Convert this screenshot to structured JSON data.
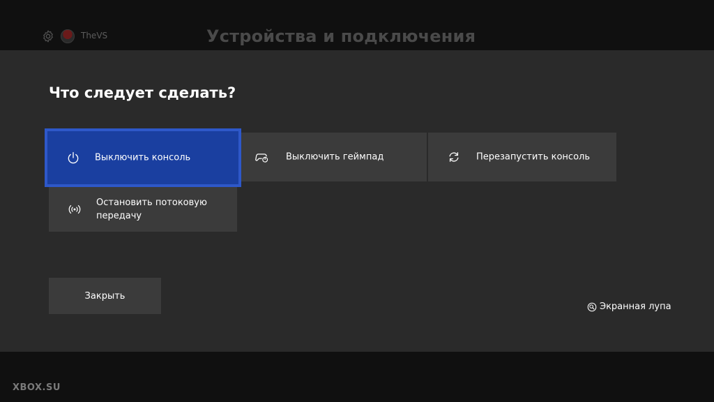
{
  "background": {
    "user_name": "TheVS",
    "page_title": "Устройства и подключения"
  },
  "dialog": {
    "title": "Что следует сделать?",
    "options": [
      {
        "label": "Выключить консоль",
        "icon": "power-icon",
        "focused": true
      },
      {
        "label": "Выключить геймпад",
        "icon": "controller-power-icon",
        "focused": false
      },
      {
        "label": "Перезапустить консоль",
        "icon": "restart-icon",
        "focused": false
      },
      {
        "label": "Остановить потоковую передачу",
        "icon": "broadcast-icon",
        "focused": false
      }
    ],
    "close_label": "Закрыть",
    "magnifier_label": "Экранная лупа"
  },
  "watermark": "XBOX.SU",
  "colors": {
    "focus": "#1a3fa0",
    "focus_border": "#2e58c9",
    "tile": "#3b3b3b",
    "dialog": "#2a2a2a",
    "backdrop": "#101010"
  }
}
